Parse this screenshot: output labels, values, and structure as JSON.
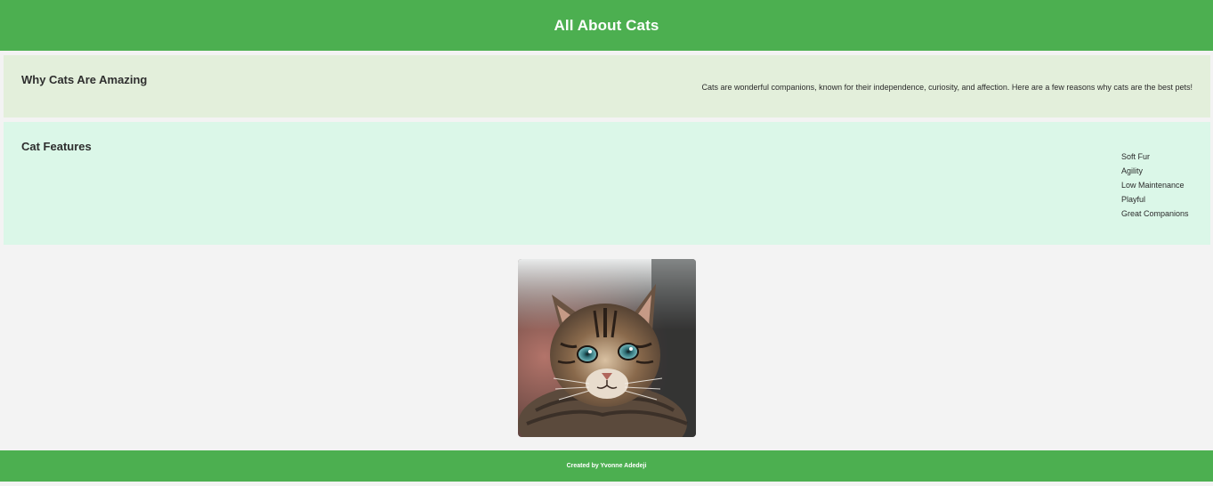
{
  "header": {
    "title": "All About Cats"
  },
  "why_section": {
    "heading": "Why Cats Are Amazing",
    "text": "Cats are wonderful companions, known for their independence, curiosity, and affection. Here are a few reasons why cats are the best pets!"
  },
  "features_section": {
    "heading": "Cat Features",
    "items": [
      "Soft Fur",
      "Agility",
      "Low Maintenance",
      "Playful",
      "Great Companions"
    ]
  },
  "image": {
    "alt": "Cat"
  },
  "footer": {
    "text": "Created by Yvonne Adedeji"
  },
  "colors": {
    "header_bg": "#4caf50",
    "why_bg": "#e3efdb",
    "features_bg": "#dbf7e8",
    "page_bg": "#f3f3f3"
  }
}
